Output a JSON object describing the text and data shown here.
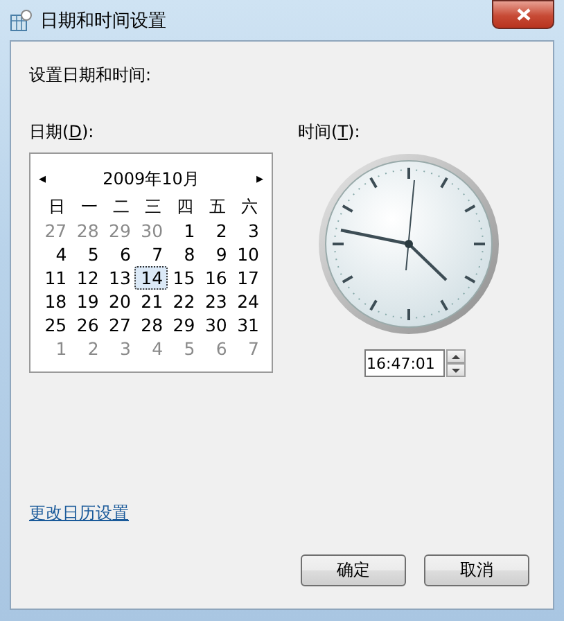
{
  "window": {
    "title": "日期和时间设置"
  },
  "heading": "设置日期和时间:",
  "date_label": {
    "before": "日期(",
    "key": "D",
    "after": "):"
  },
  "time_label": {
    "before": "时间(",
    "key": "T",
    "after": "):"
  },
  "calendar": {
    "prev": "◂",
    "month": "2009年10月",
    "next": "▸",
    "weekdays": [
      "日",
      "一",
      "二",
      "三",
      "四",
      "五",
      "六"
    ],
    "days": [
      {
        "day": "27",
        "kind": "other",
        "selected": false
      },
      {
        "day": "28",
        "kind": "other",
        "selected": false
      },
      {
        "day": "29",
        "kind": "other",
        "selected": false
      },
      {
        "day": "30",
        "kind": "other",
        "selected": false
      },
      {
        "day": "1",
        "kind": "current",
        "selected": false
      },
      {
        "day": "2",
        "kind": "current",
        "selected": false
      },
      {
        "day": "3",
        "kind": "current",
        "selected": false
      },
      {
        "day": "4",
        "kind": "current",
        "selected": false
      },
      {
        "day": "5",
        "kind": "current",
        "selected": false
      },
      {
        "day": "6",
        "kind": "current",
        "selected": false
      },
      {
        "day": "7",
        "kind": "current",
        "selected": false
      },
      {
        "day": "8",
        "kind": "current",
        "selected": false
      },
      {
        "day": "9",
        "kind": "current",
        "selected": false
      },
      {
        "day": "10",
        "kind": "current",
        "selected": false
      },
      {
        "day": "11",
        "kind": "current",
        "selected": false
      },
      {
        "day": "12",
        "kind": "current",
        "selected": false
      },
      {
        "day": "13",
        "kind": "current",
        "selected": false
      },
      {
        "day": "14",
        "kind": "current",
        "selected": true
      },
      {
        "day": "15",
        "kind": "current",
        "selected": false
      },
      {
        "day": "16",
        "kind": "current",
        "selected": false
      },
      {
        "day": "17",
        "kind": "current",
        "selected": false
      },
      {
        "day": "18",
        "kind": "current",
        "selected": false
      },
      {
        "day": "19",
        "kind": "current",
        "selected": false
      },
      {
        "day": "20",
        "kind": "current",
        "selected": false
      },
      {
        "day": "21",
        "kind": "current",
        "selected": false
      },
      {
        "day": "22",
        "kind": "current",
        "selected": false
      },
      {
        "day": "23",
        "kind": "current",
        "selected": false
      },
      {
        "day": "24",
        "kind": "current",
        "selected": false
      },
      {
        "day": "25",
        "kind": "current",
        "selected": false
      },
      {
        "day": "26",
        "kind": "current",
        "selected": false
      },
      {
        "day": "27",
        "kind": "current",
        "selected": false
      },
      {
        "day": "28",
        "kind": "current",
        "selected": false
      },
      {
        "day": "29",
        "kind": "current",
        "selected": false
      },
      {
        "day": "30",
        "kind": "current",
        "selected": false
      },
      {
        "day": "31",
        "kind": "current",
        "selected": false
      },
      {
        "day": "1",
        "kind": "other",
        "selected": false
      },
      {
        "day": "2",
        "kind": "other",
        "selected": false
      },
      {
        "day": "3",
        "kind": "other",
        "selected": false
      },
      {
        "day": "4",
        "kind": "other",
        "selected": false
      },
      {
        "day": "5",
        "kind": "other",
        "selected": false
      },
      {
        "day": "6",
        "kind": "other",
        "selected": false
      },
      {
        "day": "7",
        "kind": "other",
        "selected": false
      }
    ]
  },
  "time": {
    "value": "16:47:01"
  },
  "link": "更改日历设置",
  "buttons": [
    "确定",
    "取消"
  ]
}
